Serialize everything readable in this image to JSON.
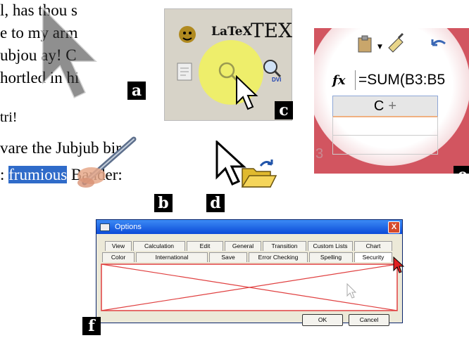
{
  "panel_a": {
    "lines": [
      "l, has thou s",
      "e to my arm",
      "ubjou  ay! C",
      "hortled in hi"
    ],
    "label": "a"
  },
  "panel_b": {
    "line1": "tri!",
    "line2": "vare the Jubjub bir",
    "line3_prefix": "",
    "highlighted": "frumious",
    "line3_suffix": "Bander:",
    "label": "b"
  },
  "panel_c": {
    "latex": "LaTeX",
    "tex": "TEX",
    "dvi": "DVI",
    "label": "c"
  },
  "panel_d": {
    "label": "d"
  },
  "panel_e": {
    "fx": "fx",
    "formula": "=SUM(B3:B5",
    "column": "C",
    "row": "3",
    "label": "e"
  },
  "dialog": {
    "title": "Options",
    "tabs_row1": [
      "View",
      "Calculation",
      "Edit",
      "General",
      "Transition",
      "Custom Lists",
      "Chart"
    ],
    "tabs_row2": [
      "Color",
      "International",
      "Save",
      "Error Checking",
      "Spelling",
      "Security"
    ],
    "ok": "OK",
    "cancel": "Cancel",
    "close": "X",
    "label": "f"
  },
  "colors": {
    "highlight": "#2f6bc9",
    "spot_yellow": "#f2f25a",
    "excel_red": "#d25560",
    "titlebar": "#0b4ad8",
    "error_red": "#e04040"
  }
}
